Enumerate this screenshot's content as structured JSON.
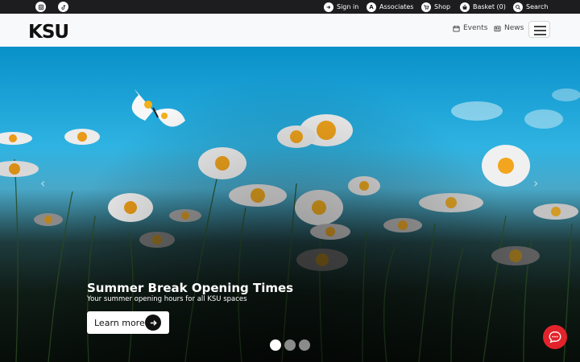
{
  "topbar": {
    "social": [
      {
        "name": "instagram-icon"
      },
      {
        "name": "tiktok-icon"
      }
    ],
    "links": {
      "sign_in": "Sign in",
      "associates": "Associates",
      "associates_icon_letter": "A",
      "shop": "Shop",
      "basket": "Basket (0)",
      "search": "Search"
    }
  },
  "header": {
    "logo": "KSU",
    "nav": {
      "events": "Events",
      "news": "News"
    }
  },
  "hero": {
    "title": "Summer Break Opening Times",
    "subtitle": "Your summer opening hours for all KSU spaces",
    "button_label": "Learn more",
    "slides_total": 3,
    "slide_active": 1,
    "prev_glyph": "‹",
    "next_glyph": "›"
  },
  "colors": {
    "topbar": "#1d1d1f",
    "chat_button": "#e3232b",
    "sky": "#2fb3e2"
  }
}
